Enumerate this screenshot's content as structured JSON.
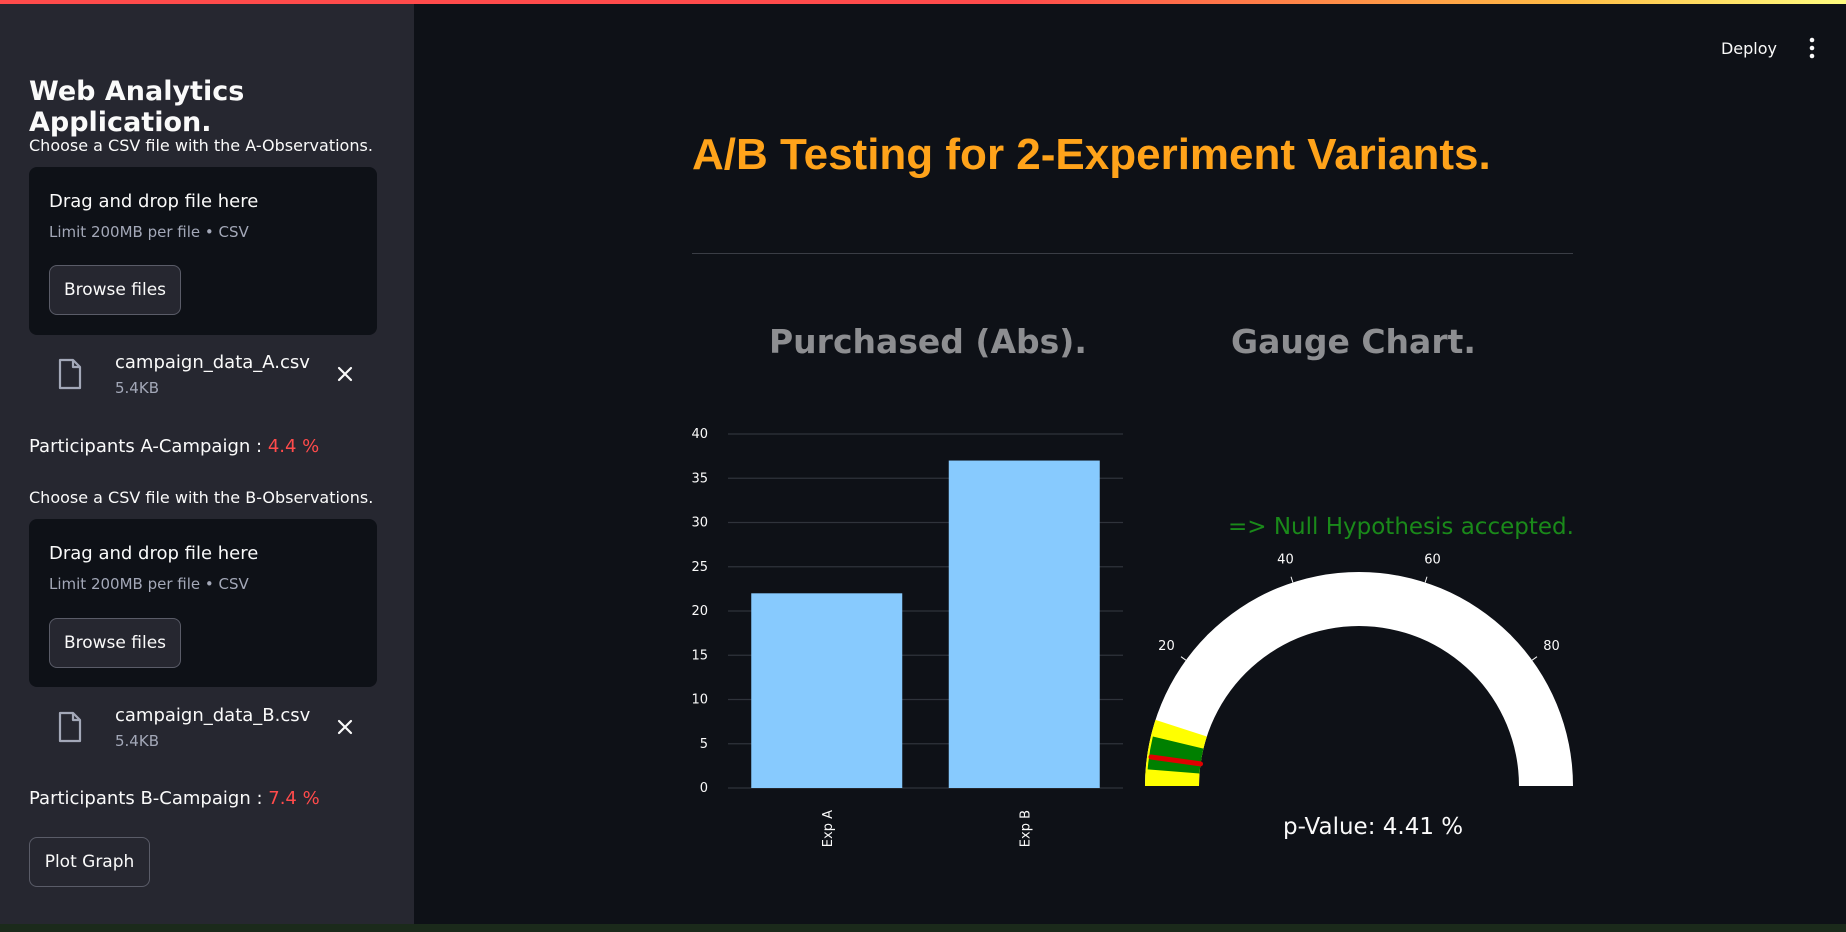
{
  "sidebar": {
    "title": "Web Analytics Application.",
    "upload_a": {
      "label": "Choose a CSV file with the A-Observations.",
      "drop_title": "Drag and drop file here",
      "drop_limit": "Limit 200MB per file • CSV",
      "browse_label": "Browse files",
      "file_name": "campaign_data_A.csv",
      "file_size": "5.4KB"
    },
    "participants_a": {
      "label": "Participants A-Campaign :",
      "value": "4.4 %"
    },
    "upload_b": {
      "label": "Choose a CSV file with the B-Observations.",
      "drop_title": "Drag and drop file here",
      "drop_limit": "Limit 200MB per file • CSV",
      "browse_label": "Browse files",
      "file_name": "campaign_data_B.csv",
      "file_size": "5.4KB"
    },
    "participants_b": {
      "label": "Participants B-Campaign :",
      "value": "7.4 %"
    },
    "plot_button": "Plot Graph"
  },
  "header": {
    "deploy_label": "Deploy",
    "menu_icon": "more-vertical-icon"
  },
  "main": {
    "title": "A/B Testing for 2-Experiment Variants.",
    "bar_section_title": "Purchased (Abs).",
    "gauge_section_title": "Gauge Chart.",
    "hypothesis_text": "=> Null Hypothesis accepted.",
    "pvalue_text": "p-Value: 4.41 %"
  },
  "colors": {
    "accent_orange": "#ffa31a",
    "bar_fill": "#87cafe",
    "sidebar_bg": "#262730",
    "app_bg": "#0e1117",
    "percent_red": "#ff4b4b",
    "hypothesis_green": "#1a8a1a"
  },
  "chart_data": [
    {
      "type": "bar",
      "categories": [
        "Exp A",
        "Exp B"
      ],
      "values": [
        22,
        37
      ],
      "ylim": [
        0,
        40
      ],
      "yticks": [
        0,
        5,
        10,
        15,
        20,
        25,
        30,
        35,
        40
      ],
      "grid": true,
      "bar_color": "#87cafe"
    },
    {
      "type": "gauge",
      "range": [
        0,
        100
      ],
      "ticks": [
        20,
        40,
        60,
        80
      ],
      "value": 4.41,
      "bands": [
        {
          "from": 0,
          "to": 10,
          "color": "#ffff00"
        },
        {
          "from": 2.5,
          "to": 7.5,
          "color": "#008000"
        }
      ],
      "needle_color": "#e00000"
    }
  ]
}
